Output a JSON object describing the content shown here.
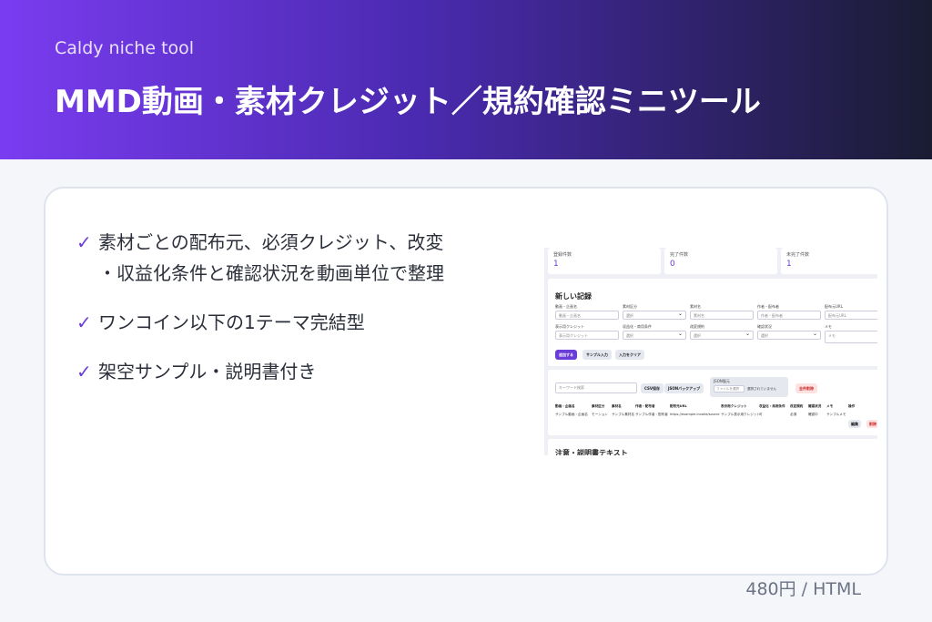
{
  "header": {
    "subtitle": "Caldy niche tool",
    "title": "MMD動画・素材クレジット／規約確認ミニツール"
  },
  "features": [
    {
      "check": "✓",
      "lines": [
        "素材ごとの配布元、必須クレジット、改変",
        "・収益化条件と確認状況を動画単位で整理"
      ]
    },
    {
      "check": "✓",
      "lines": [
        "ワンコイン以下の1テーマ完結型"
      ]
    },
    {
      "check": "✓",
      "lines": [
        "架空サンプル・説明書付き"
      ]
    }
  ],
  "price": "480円 / HTML",
  "preview": {
    "stats": [
      {
        "label": "登録件数",
        "value": "1"
      },
      {
        "label": "完了件数",
        "value": "0"
      },
      {
        "label": "未完了件数",
        "value": "1"
      }
    ],
    "form": {
      "title": "新しい記録",
      "fields": [
        {
          "label": "動画・企画名",
          "value": "動画・企画名"
        },
        {
          "label": "素材区分",
          "value": "選択"
        },
        {
          "label": "素材名",
          "value": "素材名"
        },
        {
          "label": "作者・配布者",
          "value": "作者・配布者"
        },
        {
          "label": "配布元URL",
          "value": "配布元URL"
        },
        {
          "label": "表示用クレジット",
          "value": "表示用クレジット"
        },
        {
          "label": "収益化・商用条件",
          "value": "選択"
        },
        {
          "label": "改変規約",
          "value": "選択"
        },
        {
          "label": "確認状況",
          "value": "選択"
        },
        {
          "label": "メモ",
          "value": "メモ"
        }
      ],
      "buttons": {
        "add": "追加する",
        "sample": "サンプル入力",
        "clear": "入力をクリア"
      }
    },
    "list": {
      "search_placeholder": "キーワード検索",
      "csv": "CSV保存",
      "json_backup": "JSONバックアップ",
      "json_restore": "JSON復元",
      "file_button": "ファイルを選択",
      "file_status": "選択されていません",
      "delete_all": "全件削除",
      "headers": [
        "動画・企画名",
        "素材区分",
        "素材名",
        "作者・配布者",
        "配布元URL",
        "表示用クレジット",
        "収益化・商用条件",
        "改変規約",
        "確認状況",
        "メモ",
        "操作"
      ],
      "row": [
        "サンプル動画・企画名",
        "モーション",
        "サンプル素材名",
        "サンプル作者・配布者",
        "https://example.invalid/source",
        "サンプル表示用クレジット",
        "可",
        "必須",
        "確認中",
        "サンプルメモ"
      ],
      "edit": "編集",
      "delete": "削除"
    },
    "next_section": "注意・説明書テキスト"
  }
}
